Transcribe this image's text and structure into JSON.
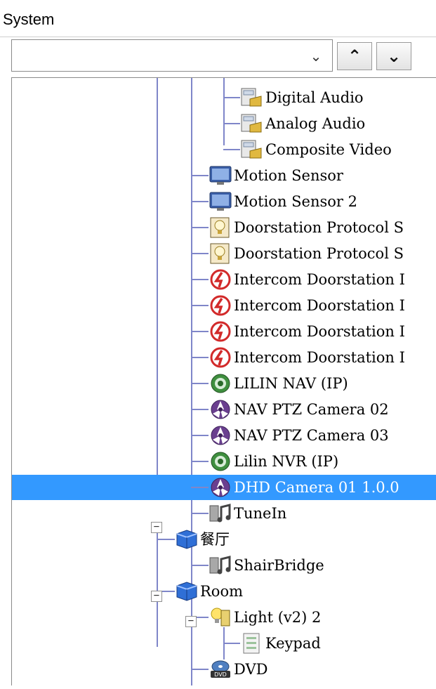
{
  "panel": {
    "title": "System"
  },
  "selector": {
    "value": "",
    "dropdown_icon": "chevron-down-icon"
  },
  "nav": {
    "up_icon": "caret-up-icon",
    "down_icon": "caret-down-icon"
  },
  "tree": {
    "selected_color": "#3399ff",
    "items": [
      {
        "label": "Digital Audio",
        "icon": "audio-port-icon"
      },
      {
        "label": "Analog Audio",
        "icon": "audio-port-icon"
      },
      {
        "label": "Composite Video",
        "icon": "video-port-icon"
      },
      {
        "label": "Motion Sensor",
        "icon": "monitor-icon"
      },
      {
        "label": "Motion Sensor 2",
        "icon": "monitor-icon"
      },
      {
        "label": "Doorstation Protocol S",
        "icon": "doorbell-icon"
      },
      {
        "label": "Doorstation Protocol S",
        "icon": "doorbell-icon"
      },
      {
        "label": "Intercom Doorstation I",
        "icon": "intercom-icon"
      },
      {
        "label": "Intercom Doorstation I",
        "icon": "intercom-icon"
      },
      {
        "label": "Intercom Doorstation I",
        "icon": "intercom-icon"
      },
      {
        "label": "Intercom Doorstation I",
        "icon": "intercom-icon"
      },
      {
        "label": "LILIN NAV (IP)",
        "icon": "nvr-icon"
      },
      {
        "label": "NAV PTZ Camera 02",
        "icon": "camera-icon"
      },
      {
        "label": "NAV PTZ Camera 03",
        "icon": "camera-icon"
      },
      {
        "label": "Lilin NVR (IP)",
        "icon": "nvr-icon"
      },
      {
        "label": "DHD Camera 01 1.0.0",
        "icon": "camera-icon"
      },
      {
        "label": "TuneIn",
        "icon": "music-icon"
      },
      {
        "label": "餐厅",
        "icon": "room-icon"
      },
      {
        "label": "ShairBridge",
        "icon": "music-icon"
      },
      {
        "label": "Room",
        "icon": "room-icon"
      },
      {
        "label": "Light (v2) 2",
        "icon": "light-icon"
      },
      {
        "label": "Keypad",
        "icon": "keypad-icon"
      },
      {
        "label": "DVD",
        "icon": "dvd-icon"
      }
    ]
  }
}
